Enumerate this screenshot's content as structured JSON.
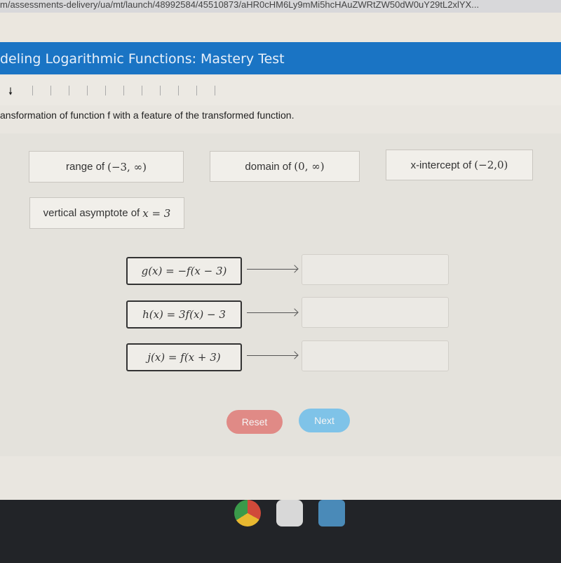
{
  "browser": {
    "url": "m/assessments-delivery/ua/mt/launch/48992584/45510873/aHR0cHM6Ly9mMi5hcHAuZWRtZW50dW0uY29tL2xlYX..."
  },
  "header": {
    "title": "deling Logarithmic Functions: Mastery Test"
  },
  "instruction": "ansformation of function f with a feature of the transformed function.",
  "features": [
    {
      "label": "range of",
      "math": "(−3, ∞)"
    },
    {
      "label": "domain of",
      "math": "(0, ∞)"
    },
    {
      "label": "x-intercept of",
      "math": "(−2,0)"
    },
    {
      "label": "vertical asymptote of",
      "math": "x = 3"
    }
  ],
  "functions": [
    {
      "expr": "g(x) = −f(x − 3)"
    },
    {
      "expr": "h(x) = 3f(x) − 3"
    },
    {
      "expr": "j(x) = f(x + 3)"
    }
  ],
  "buttons": {
    "reset": "Reset",
    "next": "Next"
  },
  "colors": {
    "header": "#1a74c4",
    "reset": "#e08a86",
    "next": "#7fc3e8"
  },
  "taskbar": {
    "icons": [
      "chrome-icon",
      "camera-icon",
      "files-icon"
    ]
  }
}
